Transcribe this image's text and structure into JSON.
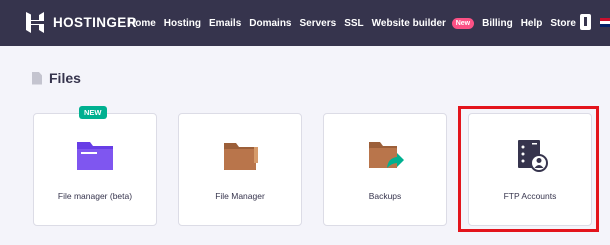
{
  "brand": {
    "name": "HOSTINGER"
  },
  "nav": {
    "items": [
      "Home",
      "Hosting",
      "Emails",
      "Domains",
      "Servers",
      "SSL"
    ],
    "website_builder": "Website builder",
    "new_badge": "New",
    "billing": "Billing",
    "help": "Help",
    "store": "Store"
  },
  "section": {
    "title": "Files"
  },
  "cards": [
    {
      "label": "File manager (beta)",
      "badge": "NEW",
      "icon": "folder-icon"
    },
    {
      "label": "File Manager",
      "icon": "folder-icon"
    },
    {
      "label": "Backups",
      "icon": "backup-folder-icon"
    },
    {
      "label": "FTP Accounts",
      "icon": "ftp-server-user-icon"
    }
  ],
  "colors": {
    "topbar": "#36344d",
    "accent_purple": "#673de6",
    "folder_brown": "#b9754b",
    "new_badge": "#00b090",
    "nav_badge": "#fc5185",
    "highlight": "#e3141c"
  }
}
